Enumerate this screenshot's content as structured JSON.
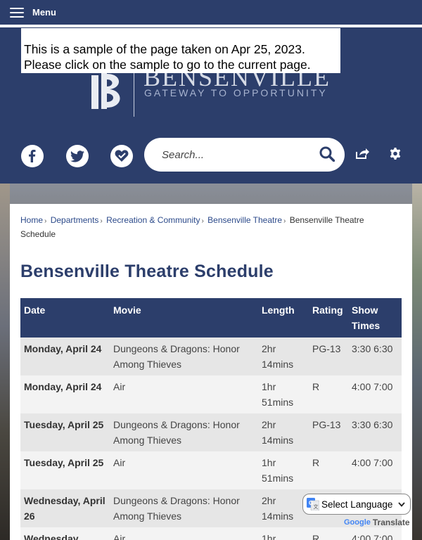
{
  "menu": {
    "label": "Menu"
  },
  "header": {
    "logo_name": "BENSENVILLE",
    "logo_tagline": "GATEWAY TO OPPORTUNITY",
    "sample_notice_line1": "This is a sample of the page taken on Apr 25, 2023.",
    "sample_notice_line2": "Please click on the sample to go to the current page.",
    "search_placeholder": "Search...",
    "social_icons": [
      "facebook-icon",
      "twitter-icon",
      "heart-icon"
    ],
    "tool_icons": [
      "share-icon",
      "gear-icon"
    ]
  },
  "breadcrumb": {
    "items": [
      "Home",
      "Departments",
      "Recreation & Community",
      "Bensenville Theatre"
    ],
    "current": "Bensenville Theatre Schedule"
  },
  "page": {
    "title": "Bensenville Theatre Schedule"
  },
  "schedule": {
    "headers": [
      "Date",
      "Movie",
      "Length",
      "Rating",
      "Show Times"
    ],
    "rows": [
      {
        "date": "Monday, April 24",
        "movie": "Dungeons & Dragons: Honor Among Thieves",
        "length": "2hr 14mins",
        "rating": "PG-13",
        "times": "3:30 6:30"
      },
      {
        "date": "Monday, April 24",
        "movie": "Air",
        "length": "1hr 51mins",
        "rating": "R",
        "times": "4:00 7:00"
      },
      {
        "date": "Tuesday, April 25",
        "movie": "Dungeons & Dragons: Honor Among Thieves",
        "length": "2hr 14mins",
        "rating": "PG-13",
        "times": "3:30 6:30"
      },
      {
        "date": "Tuesday, April 25",
        "movie": "Air",
        "length": "1hr 51mins",
        "rating": "R",
        "times": "4:00 7:00"
      },
      {
        "date": "Wednesday, April 26",
        "movie": "Dungeons & Dragons: Honor Among Thieves",
        "length": "2hr 14mins",
        "rating": "",
        "times": ""
      },
      {
        "date": "Wednesday,",
        "movie": "Air",
        "length": "1hr",
        "rating": "R",
        "times": "4:00 7:00"
      }
    ]
  },
  "translate": {
    "label": "Select Language",
    "powered_by": "Google",
    "powered_suffix": "Translate"
  },
  "colors": {
    "brand_navy": "#2c3e6b",
    "link_blue": "#2c4a8a",
    "row_odd": "#e6e6e6",
    "row_even": "#f3f3f3"
  }
}
